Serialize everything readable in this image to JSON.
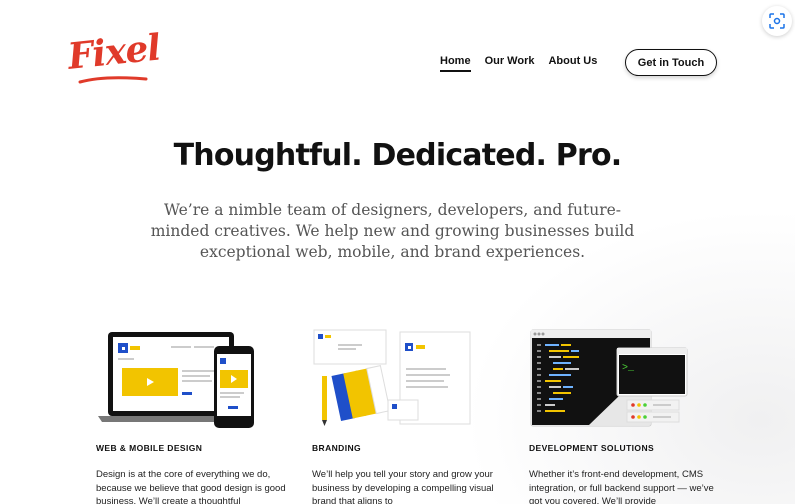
{
  "brand": {
    "logo_text": "Fixel",
    "colors": {
      "logo": "#e03a2a",
      "accent_yellow": "#f2c400",
      "accent_blue": "#1f4fc9",
      "text": "#111111"
    }
  },
  "nav": {
    "items": [
      {
        "label": "Home",
        "active": true
      },
      {
        "label": "Our Work",
        "active": false
      },
      {
        "label": "About Us",
        "active": false
      }
    ]
  },
  "cta": {
    "label": "Get in Touch"
  },
  "scan_icon": "scan-icon",
  "hero": {
    "headline": "Thoughtful. Dedicated. Pro.",
    "subhead": "We’re a nimble team of designers, developers, and future-minded creatives. We help new and growing businesses build exceptional web, mobile, and brand experiences."
  },
  "services": [
    {
      "title": "WEB & MOBILE DESIGN",
      "text": "Design is at the core of everything we do, because we believe that good design is good business. We’ll create a thoughtful",
      "icon": "devices-illustration"
    },
    {
      "title": "BRANDING",
      "text": "We’ll help you tell your story and grow your business by developing a compelling visual brand that aligns to",
      "icon": "stationery-illustration"
    },
    {
      "title": "DEVELOPMENT SOLUTIONS",
      "text": "Whether it’s front-end development, CMS integration, or full backend support — we’ve got you covered. We’ll provide",
      "icon": "code-editor-illustration"
    }
  ]
}
